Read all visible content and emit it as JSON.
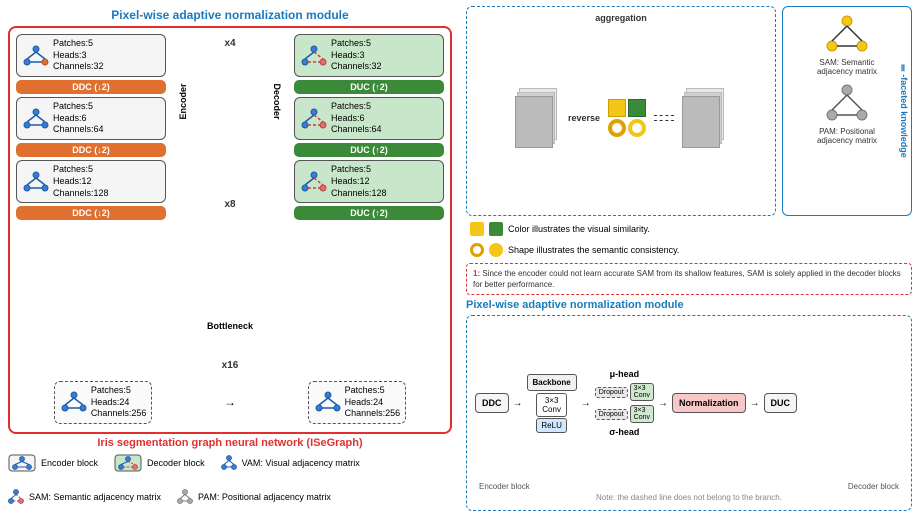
{
  "left": {
    "pixel_wise_title": "Pixel-wise adaptive normalization module",
    "encoder_blocks": [
      {
        "patches": "Patches:5",
        "heads": "Heads:3",
        "channels": "Channels:32"
      },
      {
        "patches": "Patches:5",
        "heads": "Heads:6",
        "channels": "Channels:64"
      },
      {
        "patches": "Patches:5",
        "heads": "Heads:12",
        "channels": "Channels:128"
      }
    ],
    "decoder_blocks": [
      {
        "patches": "Patches:5",
        "heads": "Heads:3",
        "channels": "Channels:32"
      },
      {
        "patches": "Patches:5",
        "heads": "Heads:6",
        "channels": "Channels:64"
      },
      {
        "patches": "Patches:5",
        "heads": "Heads:12",
        "channels": "Channels:128"
      }
    ],
    "bottleneck_enc": {
      "patches": "Patches:5",
      "heads": "Heads:24",
      "channels": "Channels:256"
    },
    "bottleneck_dec": {
      "patches": "Patches:5",
      "heads": "Heads:24",
      "channels": "Channels:256"
    },
    "ddc_labels": [
      "DDC (↓2)",
      "DDC (↓2)",
      "DDC (↓2)"
    ],
    "duc_labels": [
      "DUC (↑2)",
      "DUC (↑2)",
      "DUC (↑2)"
    ],
    "x_labels": [
      "x4",
      "x8",
      "x16"
    ],
    "encoder_label": "Encoder",
    "decoder_label": "Decoder",
    "bottleneck_label": "Bottleneck",
    "iris_title": "Iris segmentation graph neural network (ISeGraph)",
    "legend": {
      "encoder_block": "Encoder block",
      "decoder_block": "Decoder block",
      "vam": "VAM: Visual adjacency matrix",
      "sam": "SAM: Semantic adjacency matrix",
      "pam": "PAM: Positional adjacency matrix"
    }
  },
  "right": {
    "color_legend": "Color illustrates the visual similarity.",
    "shape_legend": "Shape illustrates the semantic consistency.",
    "note": "1: Since the encoder could not learn accurate SAM from its shallow features, SAM is solely applied in the decoder blocks for better performance.",
    "pixel_wise_title": "Pixel-wise adaptive normalization module",
    "diagram_labels": {
      "ddc": "DDC",
      "backbone": "Backbone",
      "relu": "ReLU",
      "conv": "3×3\nConv",
      "dropout": "Dropout",
      "mu_head": "μ-head",
      "sigma_head": "σ-head",
      "normalization": "Normalization",
      "duc": "DUC",
      "encoder_block": "Encoder block",
      "decoder_block": "Decoder block"
    },
    "note_bottom": "Note: the dashed line does not belong to the branch.",
    "aggregation_title": "aggregation",
    "sam_label": "SAM: Semantic\nadjacency matrix",
    "pam_label": "PAM: Positional\nadjacency matrix",
    "reverse_label": "reverse",
    "multi_faceted_label": "Ⅱ-faceted knowledge"
  }
}
